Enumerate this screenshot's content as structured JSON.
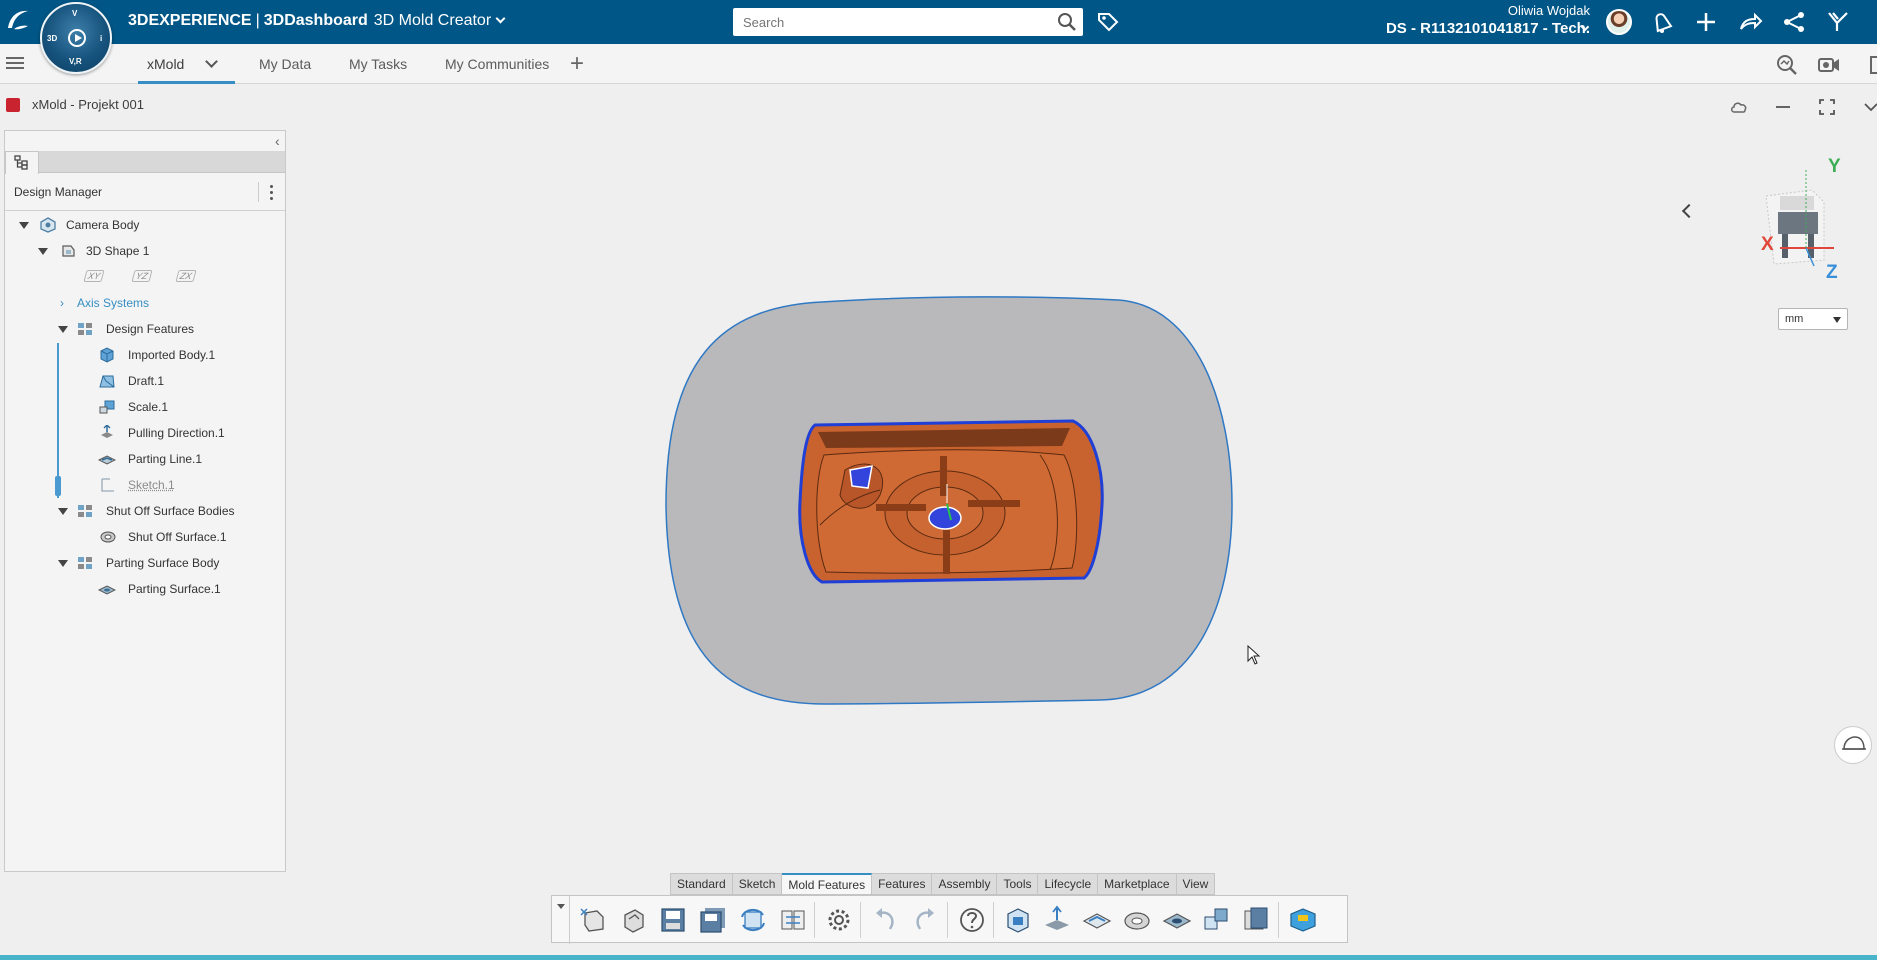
{
  "topbar": {
    "brand_prefix": "3DEXPERIENCE",
    "brand_separator": "|",
    "brand_dashboard": "3DDashboard",
    "app_name": "3D Mold Creator",
    "search_placeholder": "Search",
    "user_name": "Oliwia Wojdak",
    "tenant": "DS - R1132101041817 - Tech.",
    "compass_labels": {
      "top": "V",
      "left": "3D",
      "right": "i",
      "bottom": "V,R"
    },
    "accent_color": "#005686"
  },
  "tabs": {
    "items": [
      {
        "label": "xMold"
      },
      {
        "label": "My Data"
      },
      {
        "label": "My Tasks"
      },
      {
        "label": "My Communities"
      }
    ],
    "add_label": "+"
  },
  "breadcrumb": {
    "title": "xMold - Projekt 001"
  },
  "tree": {
    "panel_title": "Design Manager",
    "nodes": [
      {
        "label": "Camera Body",
        "icon": "part-icon"
      },
      {
        "label": "3D Shape 1",
        "icon": "shape-icon"
      },
      {
        "label": "Axis Systems",
        "icon": "expand-chevron-icon"
      },
      {
        "label": "Design Features",
        "icon": "feature-set-icon"
      },
      {
        "label": "Imported Body.1",
        "icon": "imported-body-icon"
      },
      {
        "label": "Draft.1",
        "icon": "draft-icon"
      },
      {
        "label": "Scale.1",
        "icon": "scale-icon"
      },
      {
        "label": "Pulling Direction.1",
        "icon": "pulling-direction-icon"
      },
      {
        "label": "Parting Line.1",
        "icon": "parting-line-icon"
      },
      {
        "label": "Sketch.1",
        "icon": "sketch-icon"
      },
      {
        "label": "Shut Off Surface Bodies",
        "icon": "feature-set-icon"
      },
      {
        "label": "Shut Off Surface.1",
        "icon": "shut-off-surface-icon"
      },
      {
        "label": "Parting Surface Body",
        "icon": "feature-set-icon"
      },
      {
        "label": "Parting Surface.1",
        "icon": "parting-surface-icon"
      }
    ],
    "planes": [
      "XY",
      "YZ",
      "ZX"
    ]
  },
  "viewport": {
    "units": "mm",
    "axis_labels": {
      "x": "X",
      "y": "Y",
      "z": "Z"
    },
    "model_colors": {
      "parting_surface": "#b9b9bc",
      "core": "#c8622e",
      "edge": "#1f3fd6"
    }
  },
  "action_bar": {
    "tabs": [
      "Standard",
      "Sketch",
      "Mold Features",
      "Features",
      "Assembly",
      "Tools",
      "Lifecycle",
      "Marketplace",
      "View"
    ],
    "active_tab": "Mold Features",
    "icons": [
      "new-icon",
      "open-icon",
      "save-icon",
      "save-all-icon",
      "refresh-icon",
      "compare-icon",
      "settings-icon",
      "undo-icon",
      "redo-icon",
      "help-icon",
      "mold-part-icon",
      "pulling-direction-tool-icon",
      "parting-line-tool-icon",
      "shut-off-tool-icon",
      "parting-surface-tool-icon",
      "split-tool-icon",
      "mold-base-icon",
      "render-icon"
    ]
  }
}
